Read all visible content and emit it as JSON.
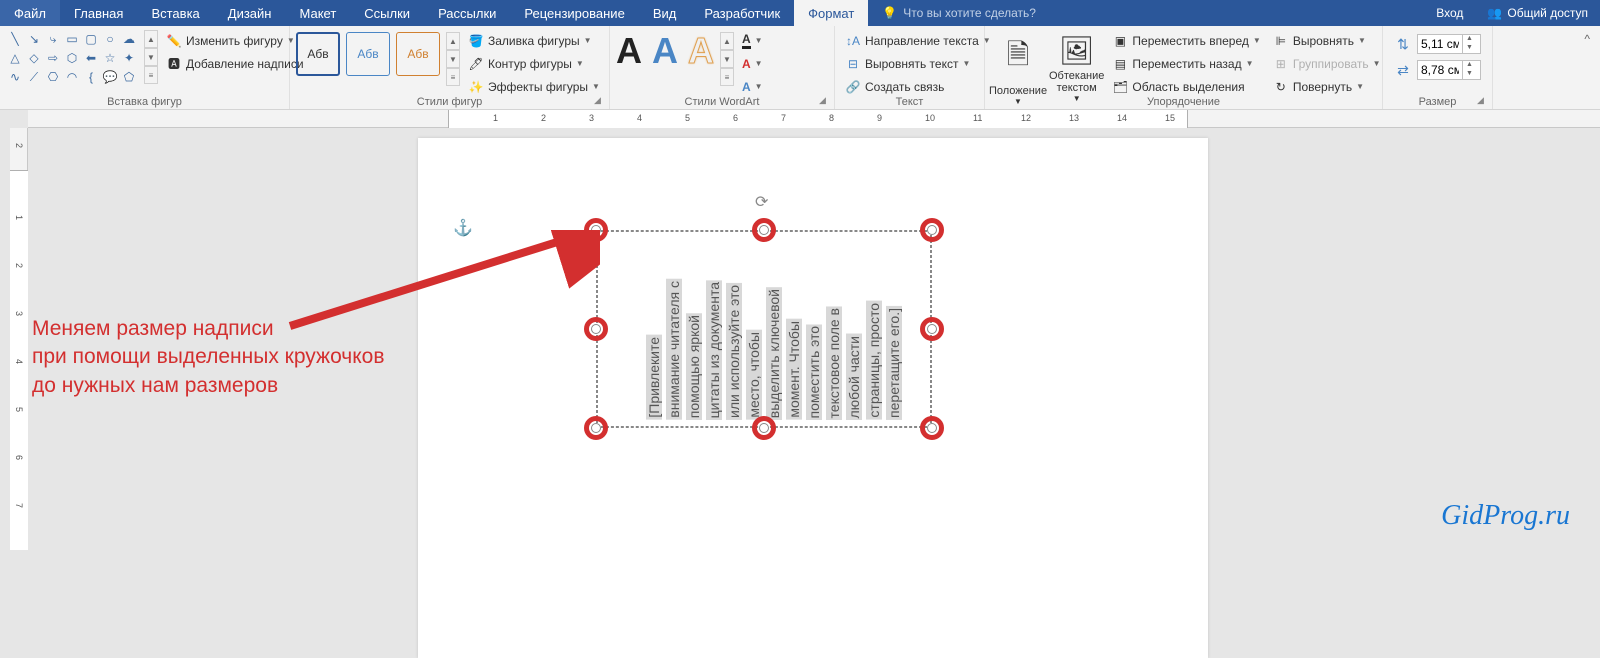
{
  "tabs": {
    "file": "Файл",
    "home": "Главная",
    "insert": "Вставка",
    "design": "Дизайн",
    "layout": "Макет",
    "references": "Ссылки",
    "mailings": "Рассылки",
    "review": "Рецензирование",
    "view": "Вид",
    "developer": "Разработчик",
    "format": "Формат",
    "tell_me": "Что вы хотите сделать?",
    "sign_in": "Вход",
    "share": "Общий доступ"
  },
  "ribbon": {
    "insert_shapes": {
      "edit_shape": "Изменить фигуру",
      "text_box": "Добавление надписи",
      "group_label": "Вставка фигур"
    },
    "shape_styles": {
      "preset_label": "Абв",
      "fill": "Заливка фигуры",
      "outline": "Контур фигуры",
      "effects": "Эффекты фигуры",
      "group_label": "Стили фигур"
    },
    "wordart_styles": {
      "group_label": "Стили WordArt"
    },
    "text": {
      "direction": "Направление текста",
      "align": "Выровнять текст",
      "create_link": "Создать связь",
      "group_label": "Текст"
    },
    "arrange": {
      "position": "Положение",
      "wrap_text": "Обтекание текстом",
      "bring_forward": "Переместить вперед",
      "send_backward": "Переместить назад",
      "selection_pane": "Область выделения",
      "align": "Выровнять",
      "group": "Группировать",
      "rotate": "Повернуть",
      "group_label": "Упорядочение"
    },
    "size": {
      "height": "5,11 см",
      "width": "8,78 см",
      "group_label": "Размер"
    }
  },
  "document": {
    "textbox_lines": [
      "[Привлеките",
      "внимание читателя с",
      "помощью яркой",
      "цитаты из документа",
      "или используйте это",
      "место, чтобы",
      "выделить ключевой",
      "момент. Чтобы",
      "поместить это",
      "текстовое поле в",
      "любой части",
      "страницы, просто",
      "перетащите его.]"
    ]
  },
  "annotation": {
    "line1": "Меняем размер надписи",
    "line2": "при помощи выделенных кружочков",
    "line3": "до нужных нам размеров"
  },
  "watermark": "GidProg.ru"
}
